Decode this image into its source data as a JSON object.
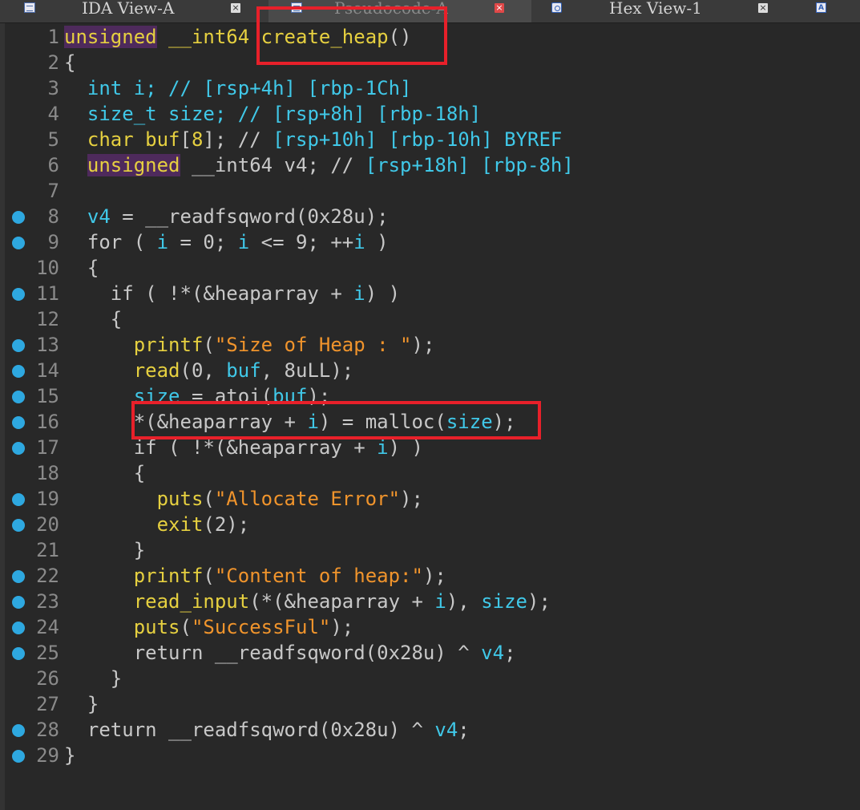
{
  "tabs": [
    {
      "label": "IDA View-A",
      "icon": "disassembly-icon",
      "close": "×",
      "active": false
    },
    {
      "label": "Pseudocode-A",
      "icon": "pseudocode-icon",
      "close": "×",
      "active": true
    },
    {
      "label": "Hex View-1",
      "icon": "hex-icon",
      "close": "×",
      "active": false
    },
    {
      "label": "",
      "icon": "structures-icon",
      "icon_text": "A",
      "active": false
    }
  ],
  "colors": {
    "background": "#282828",
    "keyword": "#c8c8c8",
    "variable": "#40c8e8",
    "function": "#e6d040",
    "string": "#f0942c",
    "unsigned_highlight": "#4e2a5c",
    "breakpoint_dot": "#2ea8e0",
    "highlight_box": "#e8202a"
  },
  "code_lines": [
    {
      "num": "1",
      "bp": false,
      "tokens": [
        [
          "uns",
          "unsigned"
        ],
        [
          "pl",
          " "
        ],
        [
          "fn",
          "__int64"
        ],
        [
          "pl",
          " "
        ],
        [
          "fn",
          "create_heap"
        ],
        [
          "pl",
          "()"
        ]
      ]
    },
    {
      "num": "2",
      "bp": false,
      "tokens": [
        [
          "pl",
          "{"
        ]
      ]
    },
    {
      "num": "3",
      "bp": false,
      "tokens": [
        [
          "pl",
          "  "
        ],
        [
          "var",
          "int i; // [rsp+4h] [rbp-1Ch]"
        ]
      ]
    },
    {
      "num": "4",
      "bp": false,
      "tokens": [
        [
          "pl",
          "  "
        ],
        [
          "var",
          "size_t size; // [rsp+8h] [rbp-18h]"
        ]
      ]
    },
    {
      "num": "5",
      "bp": false,
      "tokens": [
        [
          "pl",
          "  "
        ],
        [
          "fn",
          "char buf"
        ],
        [
          "pl",
          "["
        ],
        [
          "fn",
          "8"
        ],
        [
          "pl",
          "]; // "
        ],
        [
          "com",
          "[rsp+10h] [rbp-10h] BYREF"
        ]
      ]
    },
    {
      "num": "6",
      "bp": false,
      "tokens": [
        [
          "pl",
          "  "
        ],
        [
          "uns",
          "unsigned"
        ],
        [
          "pl",
          " __int64 "
        ],
        [
          "pl",
          "v4; // "
        ],
        [
          "com",
          "[rsp+18h] [rbp-8h]"
        ]
      ]
    },
    {
      "num": "7",
      "bp": false,
      "tokens": []
    },
    {
      "num": "8",
      "bp": true,
      "tokens": [
        [
          "pl",
          "  "
        ],
        [
          "var",
          "v4"
        ],
        [
          "pl",
          " = __readfsqword(0x28u);"
        ]
      ]
    },
    {
      "num": "9",
      "bp": true,
      "tokens": [
        [
          "pl",
          "  for ( "
        ],
        [
          "var",
          "i"
        ],
        [
          "pl",
          " = 0; "
        ],
        [
          "var",
          "i"
        ],
        [
          "pl",
          " <= 9; ++"
        ],
        [
          "var",
          "i"
        ],
        [
          "pl",
          " )"
        ]
      ]
    },
    {
      "num": "10",
      "bp": false,
      "tokens": [
        [
          "pl",
          "  {"
        ]
      ]
    },
    {
      "num": "11",
      "bp": true,
      "tokens": [
        [
          "pl",
          "    if ( !*(&heaparray + "
        ],
        [
          "var",
          "i"
        ],
        [
          "pl",
          ") )"
        ]
      ]
    },
    {
      "num": "12",
      "bp": false,
      "tokens": [
        [
          "pl",
          "    {"
        ]
      ]
    },
    {
      "num": "13",
      "bp": true,
      "tokens": [
        [
          "pl",
          "      "
        ],
        [
          "fn",
          "printf"
        ],
        [
          "pl",
          "("
        ],
        [
          "str",
          "\"Size of Heap : \""
        ],
        [
          "pl",
          ");"
        ]
      ]
    },
    {
      "num": "14",
      "bp": true,
      "tokens": [
        [
          "pl",
          "      "
        ],
        [
          "fn",
          "read"
        ],
        [
          "pl",
          "(0, "
        ],
        [
          "var",
          "buf"
        ],
        [
          "pl",
          ", 8uLL);"
        ]
      ]
    },
    {
      "num": "15",
      "bp": true,
      "tokens": [
        [
          "pl",
          "      "
        ],
        [
          "var",
          "size"
        ],
        [
          "pl",
          " = atoi("
        ],
        [
          "var",
          "buf"
        ],
        [
          "pl",
          ");"
        ]
      ]
    },
    {
      "num": "16",
      "bp": true,
      "tokens": [
        [
          "pl",
          "      *(&heaparray + "
        ],
        [
          "var",
          "i"
        ],
        [
          "pl",
          ") = malloc("
        ],
        [
          "var",
          "size"
        ],
        [
          "pl",
          ");"
        ]
      ]
    },
    {
      "num": "17",
      "bp": true,
      "tokens": [
        [
          "pl",
          "      if ( !*(&heaparray + "
        ],
        [
          "var",
          "i"
        ],
        [
          "pl",
          ") )"
        ]
      ]
    },
    {
      "num": "18",
      "bp": false,
      "tokens": [
        [
          "pl",
          "      {"
        ]
      ]
    },
    {
      "num": "19",
      "bp": true,
      "tokens": [
        [
          "pl",
          "        "
        ],
        [
          "fn",
          "puts"
        ],
        [
          "pl",
          "("
        ],
        [
          "str",
          "\"Allocate Error\""
        ],
        [
          "pl",
          ");"
        ]
      ]
    },
    {
      "num": "20",
      "bp": true,
      "tokens": [
        [
          "pl",
          "        "
        ],
        [
          "fn",
          "exit"
        ],
        [
          "pl",
          "(2);"
        ]
      ]
    },
    {
      "num": "21",
      "bp": false,
      "tokens": [
        [
          "pl",
          "      }"
        ]
      ]
    },
    {
      "num": "22",
      "bp": true,
      "tokens": [
        [
          "pl",
          "      "
        ],
        [
          "fn",
          "printf"
        ],
        [
          "pl",
          "("
        ],
        [
          "str",
          "\"Content of heap:\""
        ],
        [
          "pl",
          ");"
        ]
      ]
    },
    {
      "num": "23",
      "bp": true,
      "tokens": [
        [
          "pl",
          "      "
        ],
        [
          "fn",
          "read_input"
        ],
        [
          "pl",
          "(*(&heaparray + "
        ],
        [
          "var",
          "i"
        ],
        [
          "pl",
          "), "
        ],
        [
          "var",
          "size"
        ],
        [
          "pl",
          ");"
        ]
      ]
    },
    {
      "num": "24",
      "bp": true,
      "tokens": [
        [
          "pl",
          "      "
        ],
        [
          "fn",
          "puts"
        ],
        [
          "pl",
          "("
        ],
        [
          "str",
          "\"SuccessFul\""
        ],
        [
          "pl",
          ");"
        ]
      ]
    },
    {
      "num": "25",
      "bp": true,
      "tokens": [
        [
          "pl",
          "      return __readfsqword(0x28u) ^ "
        ],
        [
          "var",
          "v4"
        ],
        [
          "pl",
          ";"
        ]
      ]
    },
    {
      "num": "26",
      "bp": false,
      "tokens": [
        [
          "pl",
          "    }"
        ]
      ]
    },
    {
      "num": "27",
      "bp": false,
      "tokens": [
        [
          "pl",
          "  }"
        ]
      ]
    },
    {
      "num": "28",
      "bp": true,
      "tokens": [
        [
          "pl",
          "  return __readfsqword(0x28u) ^ "
        ],
        [
          "var",
          "v4"
        ],
        [
          "pl",
          ";"
        ]
      ]
    },
    {
      "num": "29",
      "bp": true,
      "tokens": [
        [
          "pl",
          "}"
        ]
      ]
    }
  ]
}
